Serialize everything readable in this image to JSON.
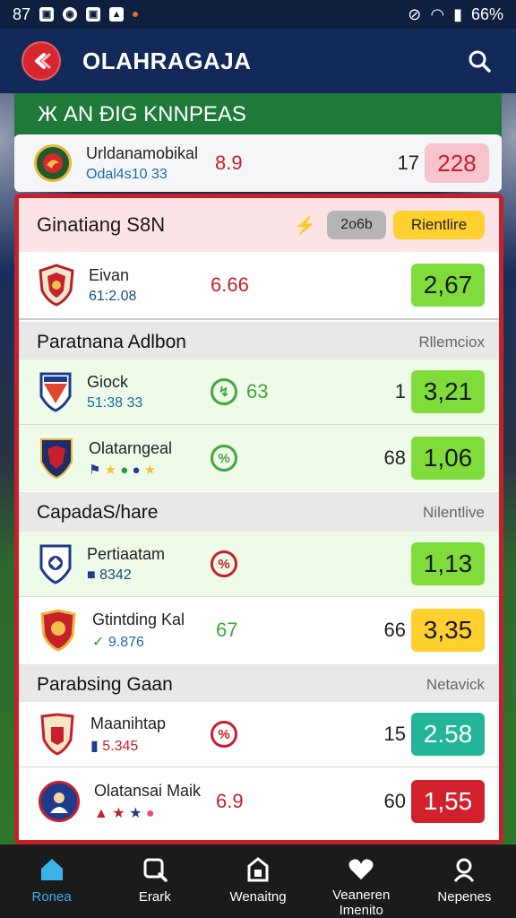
{
  "status_bar": {
    "time": "87",
    "battery": "66%"
  },
  "app_bar": {
    "title": "OLAHRAGAJA"
  },
  "banner": {
    "text": "Ж AN ÐIG KNNPEAS"
  },
  "top_match": {
    "team": "Urldanamobikal",
    "sub": "Odal4s10 33",
    "odd_mid": "8.9",
    "odd_num": "17",
    "odd_value": "228"
  },
  "featured": {
    "title": "Ginatiang S8N",
    "pill_gray": "2o6b",
    "pill_yellow": "Rientlire",
    "row": {
      "team": "Eivan",
      "sub": "61:2.08",
      "odd_mid": "6.66",
      "odd_value": "2,67"
    }
  },
  "sections": [
    {
      "title": "Paratnana Adlbon",
      "right": "Rllemciox",
      "rows": [
        {
          "team": "Giock",
          "sub": "51:38 33",
          "mid": "63",
          "num": "1",
          "value": "3,21"
        },
        {
          "team": "Olatarngeal",
          "sub": "",
          "mid": "",
          "num": "68",
          "value": "1,06"
        }
      ]
    },
    {
      "title": "CapadaS/hare",
      "right": "Nilentlive",
      "rows": [
        {
          "team": "Pertiaatam",
          "sub": "8342",
          "mid": "",
          "num": "",
          "value": "1,13"
        },
        {
          "team": "Gtintding Kal",
          "sub": "9.876",
          "mid": "67",
          "num": "66",
          "value": "3,35"
        }
      ]
    },
    {
      "title": "Parabsing Gaan",
      "right": "Netavick",
      "rows": [
        {
          "team": "Maanihtap",
          "sub": "5.345",
          "mid": "",
          "num": "15",
          "value": "2.58"
        },
        {
          "team": "Olatansai Maik",
          "sub": "",
          "mid": "6.9",
          "num": "60",
          "value": "1,55"
        }
      ]
    }
  ],
  "bottom_nav": [
    {
      "label": "Ronea",
      "active": true
    },
    {
      "label": "Erark"
    },
    {
      "label": "Wenaitng"
    },
    {
      "label": "Veaneren Imenito"
    },
    {
      "label": "Nepenes"
    }
  ],
  "colors": {
    "accent_red": "#d7262e",
    "green_odd": "#7fdc3b",
    "yellow_odd": "#ffd02e",
    "teal_odd": "#23b59a",
    "red_odd": "#d3202d",
    "pink_odd": "#f7c4cd",
    "nav_active": "#3bb3e8"
  }
}
